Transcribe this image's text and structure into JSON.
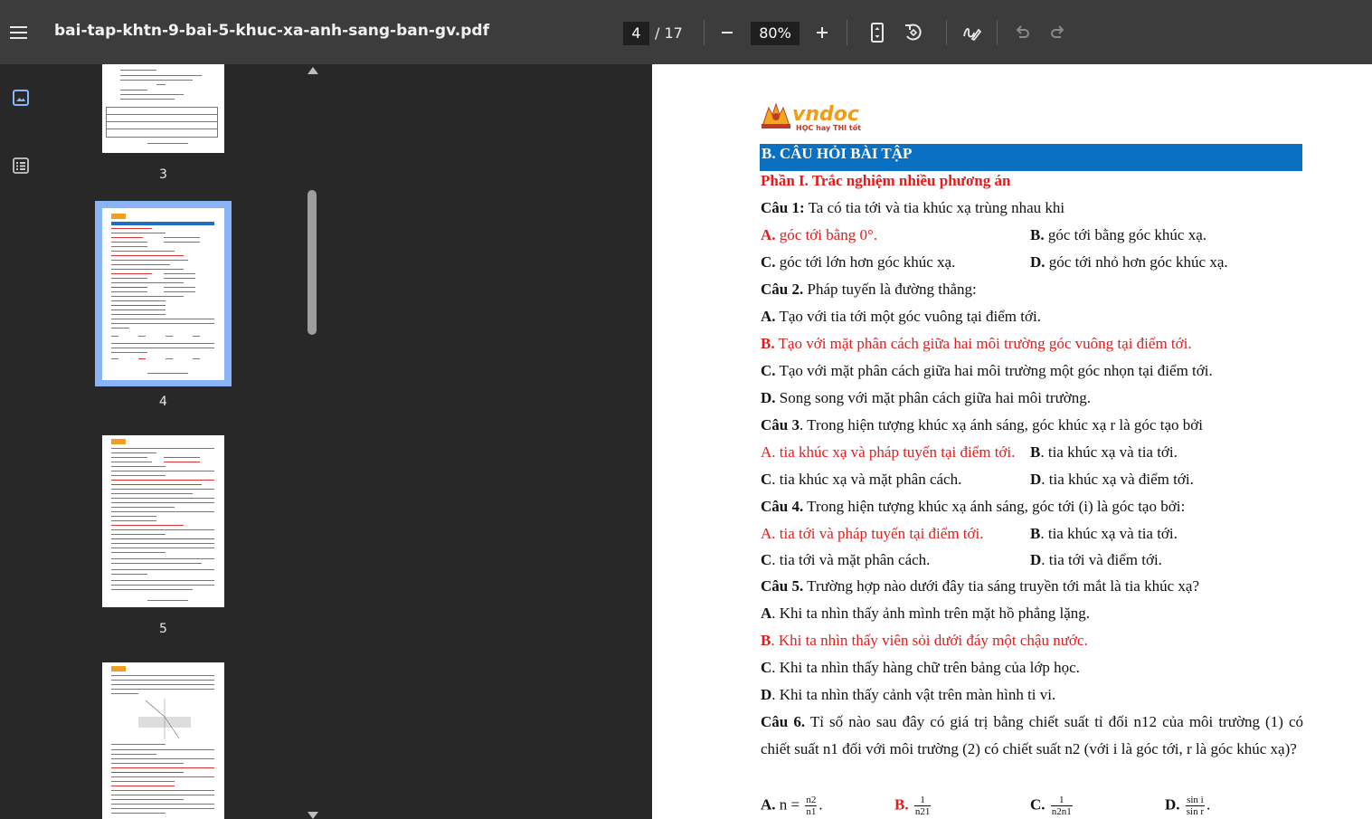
{
  "toolbar": {
    "file_name": "bai-tap-khtn-9-bai-5-khuc-xa-anh-sang-ban-gv.pdf",
    "current_page": "4",
    "total_pages": "/ 17",
    "zoom": "80%"
  },
  "thumbnails": [
    {
      "label": "3"
    },
    {
      "label": "4"
    },
    {
      "label": "5"
    }
  ],
  "page": {
    "logo_text": "vndoc",
    "logo_tagline": "HỌC hay THI tốt",
    "section_title": "B. CÂU HỎI BÀI TẬP",
    "part_title": "Phần I. Trắc nghiệm nhiều phương án",
    "q1": {
      "label": "Câu 1:",
      "text": " Ta có tia tới và tia khúc xạ trùng nhau khi",
      "a_label": "A.",
      "a_text": " góc tới bằng 0°.",
      "b_label": "B.",
      "b_text": " góc tới bằng góc khúc xạ.",
      "c_label": "C.",
      "c_text": " góc tới lớn hơn góc khúc xạ.",
      "d_label": "D.",
      "d_text": " góc tới nhỏ hơn góc khúc xạ."
    },
    "q2": {
      "label": "Câu 2.",
      "text": " Pháp tuyến là đường thẳng:",
      "a_label": "A.",
      "a_text": " Tạo với tia tới một góc vuông tại điểm tới.",
      "b_label": "B.",
      "b_text": " Tạo với mặt phân cách giữa hai môi trường góc vuông tại điểm tới.",
      "c_label": "C.",
      "c_text": " Tạo với mặt phân cách giữa hai môi trường một góc nhọn tại điểm tới.",
      "d_label": "D.",
      "d_text": " Song song với mặt phân cách giữa hai môi trường."
    },
    "q3": {
      "label": "Câu 3",
      "text": ". Trong hiện tượng khúc xạ ánh sáng, góc khúc xạ r là góc tạo bởi",
      "a_label": "A.",
      "a_text": " tia khúc xạ và pháp tuyến tại điểm tới.",
      "b_label": "B",
      "b_text": ". tia khúc xạ và tia tới.",
      "c_label": "C",
      "c_text": ". tia khúc xạ và mặt phân cách.",
      "d_label": "D",
      "d_text": ". tia khúc xạ và điểm tới."
    },
    "q4": {
      "label": "Câu 4.",
      "text": " Trong hiện tượng khúc xạ ánh sáng, góc tới (i) là góc tạo bởi:",
      "a_label": "A.",
      "a_text": " tia tới và pháp tuyến tại điểm tới.",
      "b_label": "B",
      "b_text": ". tia khúc xạ và tia tới.",
      "c_label": "C",
      "c_text": ". tia tới và mặt phân cách.",
      "d_label": "D",
      "d_text": ". tia tới và điểm tới."
    },
    "q5": {
      "label": "Câu 5.",
      "text": "  Trường hợp nào dưới đây tia sáng truyền tới mắt là tia khúc xạ?",
      "a_label": "A",
      "a_text": ". Khi ta nhìn thấy ảnh mình trên mặt hồ phẳng lặng.",
      "b_label": "B",
      "b_text": ". Khi ta nhìn thấy viên sỏi dưới đáy một chậu nước.",
      "c_label": "C",
      "c_text": ". Khi ta nhìn thấy hàng chữ trên bảng của lớp học.",
      "d_label": "D",
      "d_text": ". Khi ta nhìn thấy cảnh vật trên màn hình ti vi."
    },
    "q6": {
      "label": "Câu 6.",
      "text": " Tỉ số nào sau đây có giá trị bằng chiết suất tỉ đối n12 của môi trường (1) có chiết suất n1 đối với môi trường (2) có chiết suất n2 (với i là góc tới, r là góc khúc xạ)?",
      "a_label": "A.",
      "a_text": " n = ",
      "a_num": "n2",
      "a_den": "n1",
      "b_label": "B.",
      "b_num": "1",
      "b_den": "n21",
      "c_label": "C.",
      "c_num": "1",
      "c_den": "n2n1",
      "d_label": "D.",
      "d_num": "sin i",
      "d_den": "sin r"
    }
  }
}
